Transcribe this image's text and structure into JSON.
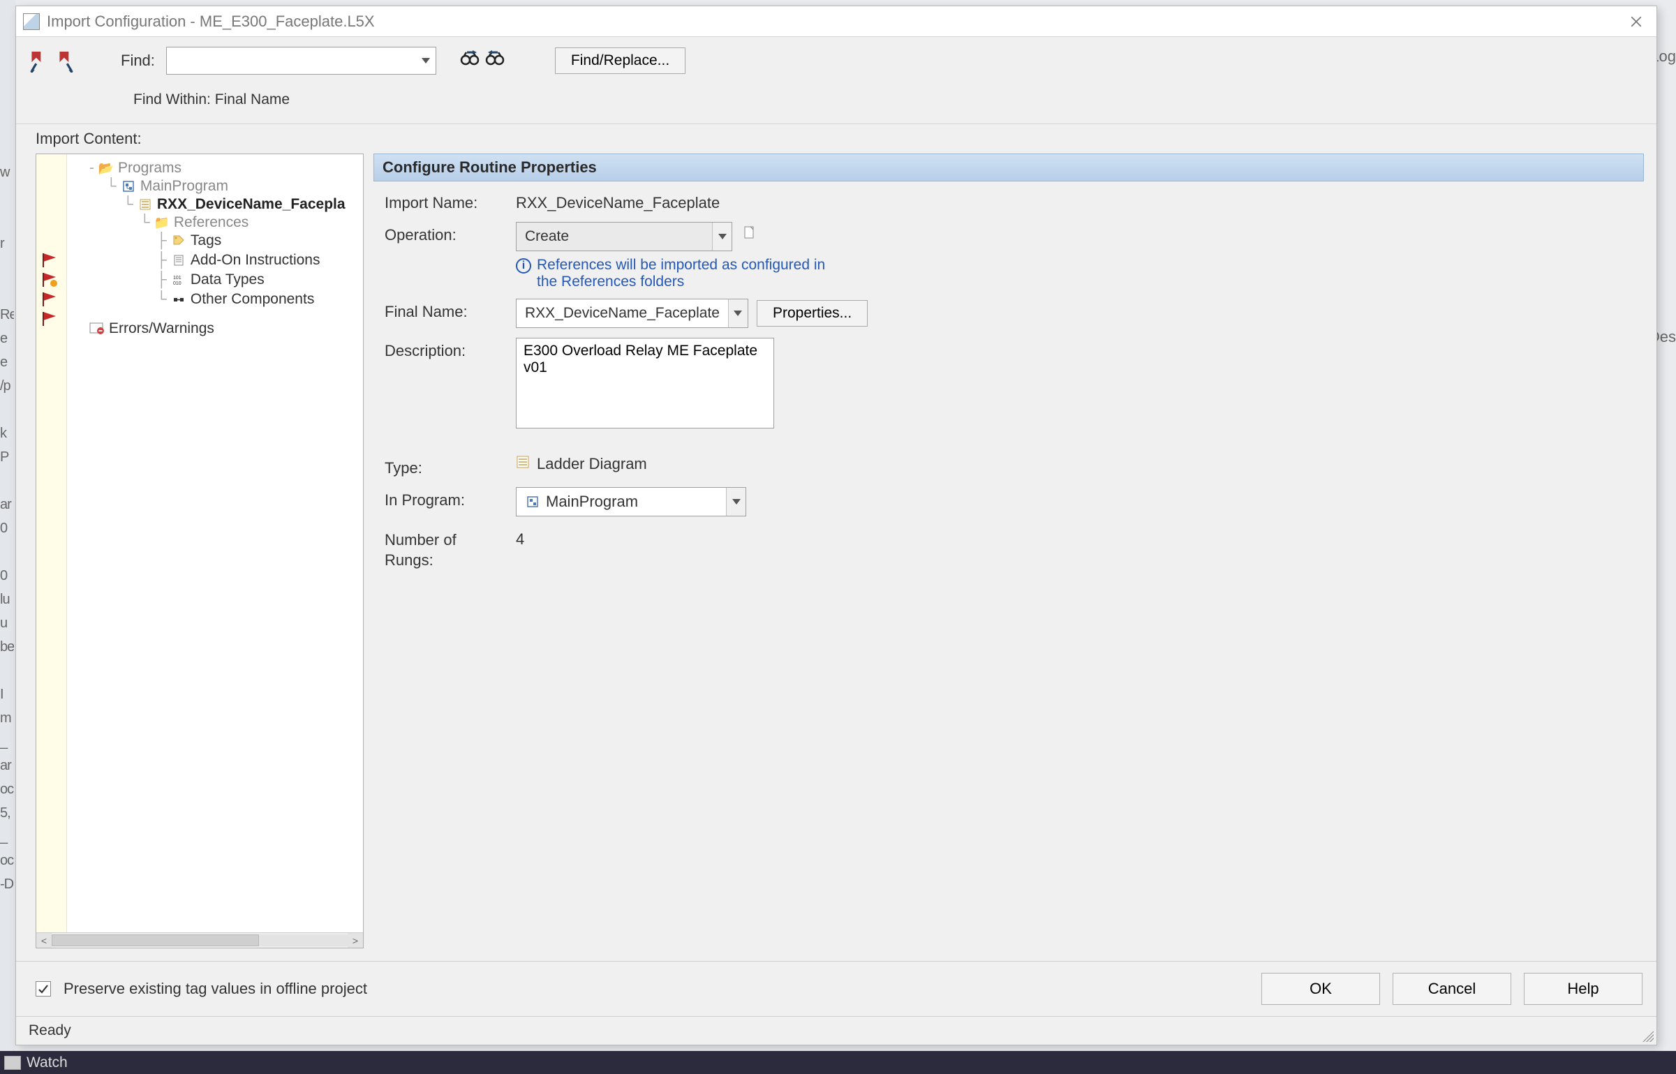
{
  "window": {
    "title": "Import Configuration - ME_E300_Faceplate.L5X"
  },
  "toolbar": {
    "find_label": "Find:",
    "find_value": "",
    "find_replace_label": "Find/Replace...",
    "find_within_label": "Find Within: Final Name"
  },
  "section": {
    "import_content_label": "Import Content:"
  },
  "tree": {
    "programs": "Programs",
    "main_program": "MainProgram",
    "routine": "RXX_DeviceName_Facepla",
    "references": "References",
    "tags": "Tags",
    "aoi": "Add-On Instructions",
    "data_types": "Data Types",
    "other_components": "Other Components",
    "errors_warnings": "Errors/Warnings"
  },
  "props": {
    "header": "Configure Routine Properties",
    "import_name_label": "Import Name:",
    "import_name_value": "RXX_DeviceName_Faceplate",
    "operation_label": "Operation:",
    "operation_value": "Create",
    "info_text": "References will be imported as configured in the References folders",
    "final_name_label": "Final Name:",
    "final_name_value": "RXX_DeviceName_Faceplate",
    "properties_button": "Properties...",
    "description_label": "Description:",
    "description_value": "E300 Overload Relay ME Faceplate v01",
    "type_label": "Type:",
    "type_value": "Ladder Diagram",
    "in_program_label": "In Program:",
    "in_program_value": "MainProgram",
    "rungs_label": "Number of Rungs:",
    "rungs_value": "4"
  },
  "footer": {
    "preserve_label": "Preserve existing tag values in offline project",
    "preserve_checked": true,
    "ok": "OK",
    "cancel": "Cancel",
    "help": "Help"
  },
  "status": {
    "text": "Ready"
  },
  "watch": {
    "label": "Watch"
  },
  "bg": {
    "log": "/Log",
    "des": "Des"
  }
}
